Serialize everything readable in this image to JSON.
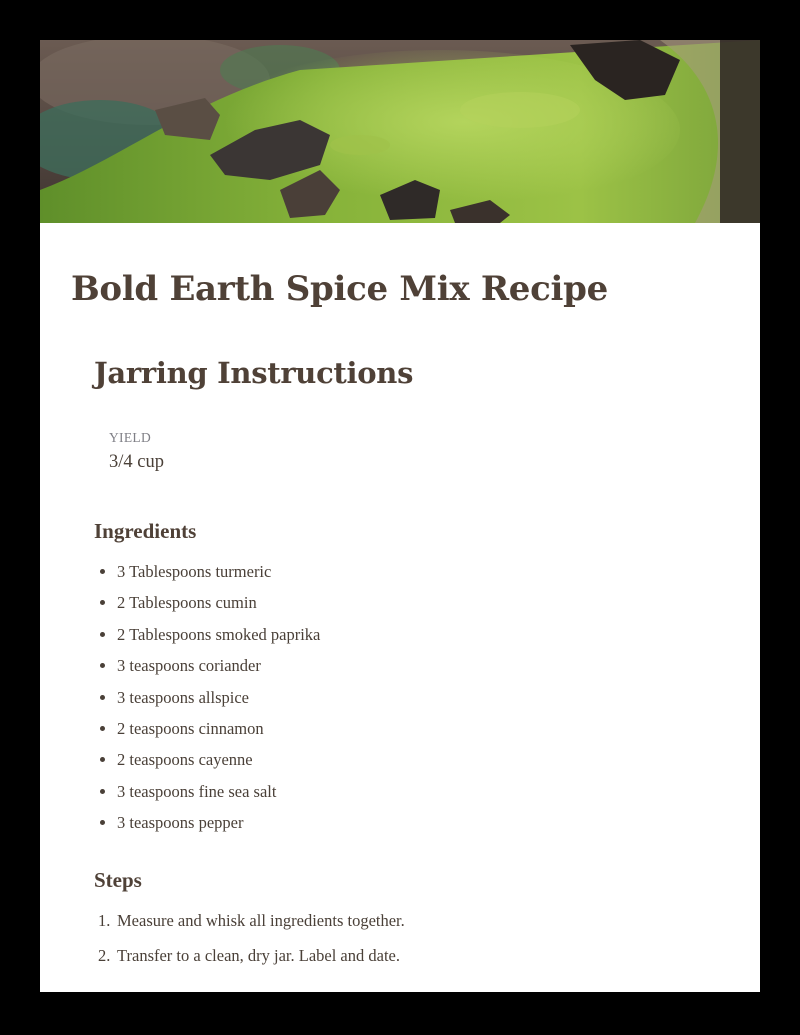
{
  "hero": {
    "image": "moss-covered-log-photo",
    "palette": {
      "moss": "#6f9a2e",
      "moss_light": "#a9c94a",
      "bark": "#3d3530",
      "background": "#5b4d47"
    }
  },
  "recipe": {
    "title": "Bold Earth Spice Mix Recipe",
    "subtitle": "Jarring Instructions",
    "yield_label": "YIELD",
    "yield_value": "3/4 cup",
    "ingredients_heading": "Ingredients",
    "ingredients": [
      "3 Tablespoons turmeric",
      "2 Tablespoons cumin",
      "2 Tablespoons smoked paprika",
      "3 teaspoons coriander",
      "3 teaspoons allspice",
      "2 teaspoons cinnamon",
      "2 teaspoons cayenne",
      "3 teaspoons fine sea salt",
      "3 teaspoons pepper"
    ],
    "steps_heading": "Steps",
    "steps": [
      {
        "number": "1.",
        "text": "Measure and whisk all ingredients together."
      },
      {
        "number": "2.",
        "text": "Transfer to a clean, dry jar. Label and date."
      }
    ]
  },
  "colors": {
    "heading": "#4f4137",
    "body_text": "#4a4038",
    "label": "#7f7f86",
    "page_background": "#000000",
    "card": "#ffffff"
  }
}
